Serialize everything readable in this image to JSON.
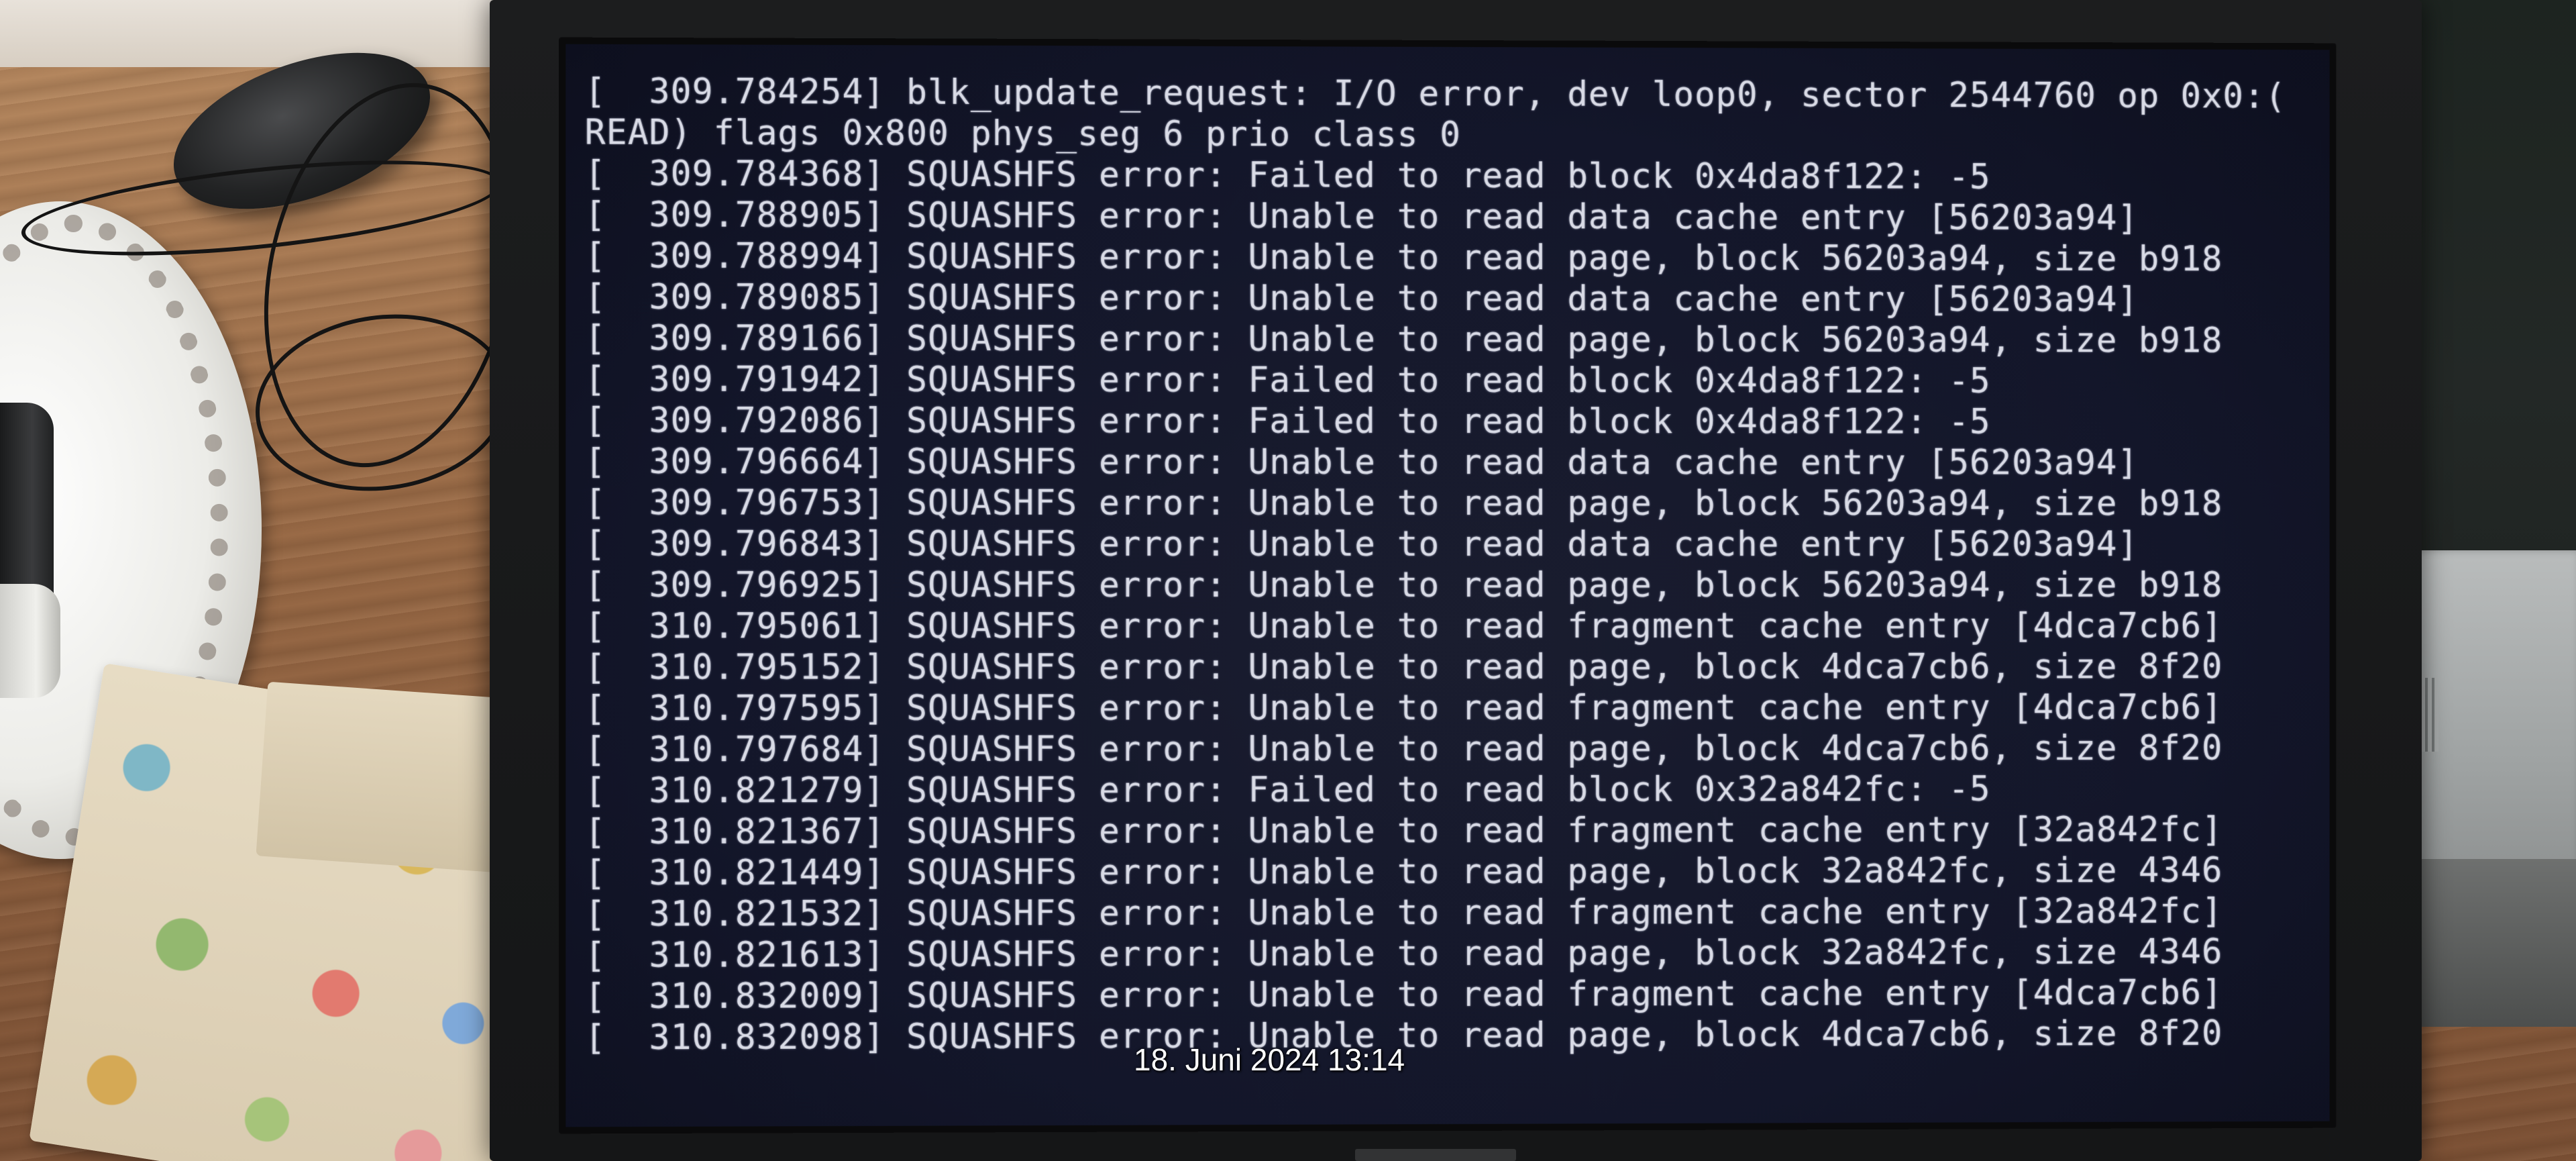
{
  "console": {
    "lines": [
      "[  309.784254] blk_update_request: I/O error, dev loop0, sector 2544760 op 0x0:(",
      "READ) flags 0x800 phys_seg 6 prio class 0",
      "[  309.784368] SQUASHFS error: Failed to read block 0x4da8f122: -5",
      "[  309.788905] SQUASHFS error: Unable to read data cache entry [56203a94]",
      "[  309.788994] SQUASHFS error: Unable to read page, block 56203a94, size b918",
      "[  309.789085] SQUASHFS error: Unable to read data cache entry [56203a94]",
      "[  309.789166] SQUASHFS error: Unable to read page, block 56203a94, size b918",
      "[  309.791942] SQUASHFS error: Failed to read block 0x4da8f122: -5",
      "[  309.792086] SQUASHFS error: Failed to read block 0x4da8f122: -5",
      "[  309.796664] SQUASHFS error: Unable to read data cache entry [56203a94]",
      "[  309.796753] SQUASHFS error: Unable to read page, block 56203a94, size b918",
      "[  309.796843] SQUASHFS error: Unable to read data cache entry [56203a94]",
      "[  309.796925] SQUASHFS error: Unable to read page, block 56203a94, size b918",
      "[  310.795061] SQUASHFS error: Unable to read fragment cache entry [4dca7cb6]",
      "[  310.795152] SQUASHFS error: Unable to read page, block 4dca7cb6, size 8f20",
      "[  310.797595] SQUASHFS error: Unable to read fragment cache entry [4dca7cb6]",
      "[  310.797684] SQUASHFS error: Unable to read page, block 4dca7cb6, size 8f20",
      "[  310.821279] SQUASHFS error: Failed to read block 0x32a842fc: -5",
      "[  310.821367] SQUASHFS error: Unable to read fragment cache entry [32a842fc]",
      "[  310.821449] SQUASHFS error: Unable to read page, block 32a842fc, size 4346",
      "[  310.821532] SQUASHFS error: Unable to read fragment cache entry [32a842fc]",
      "[  310.821613] SQUASHFS error: Unable to read page, block 32a842fc, size 4346",
      "[  310.832009] SQUASHFS error: Unable to read fragment cache entry [4dca7cb6]",
      "[  310.832098] SQUASHFS error: Unable to read page, block 4dca7cb6, size 8f20"
    ]
  },
  "photo_timestamp": "18. Juni 2024 13:14",
  "colors": {
    "console_text": "#d9dbe6",
    "console_background": "#13162a",
    "timestamp_text": "#ffffff"
  }
}
